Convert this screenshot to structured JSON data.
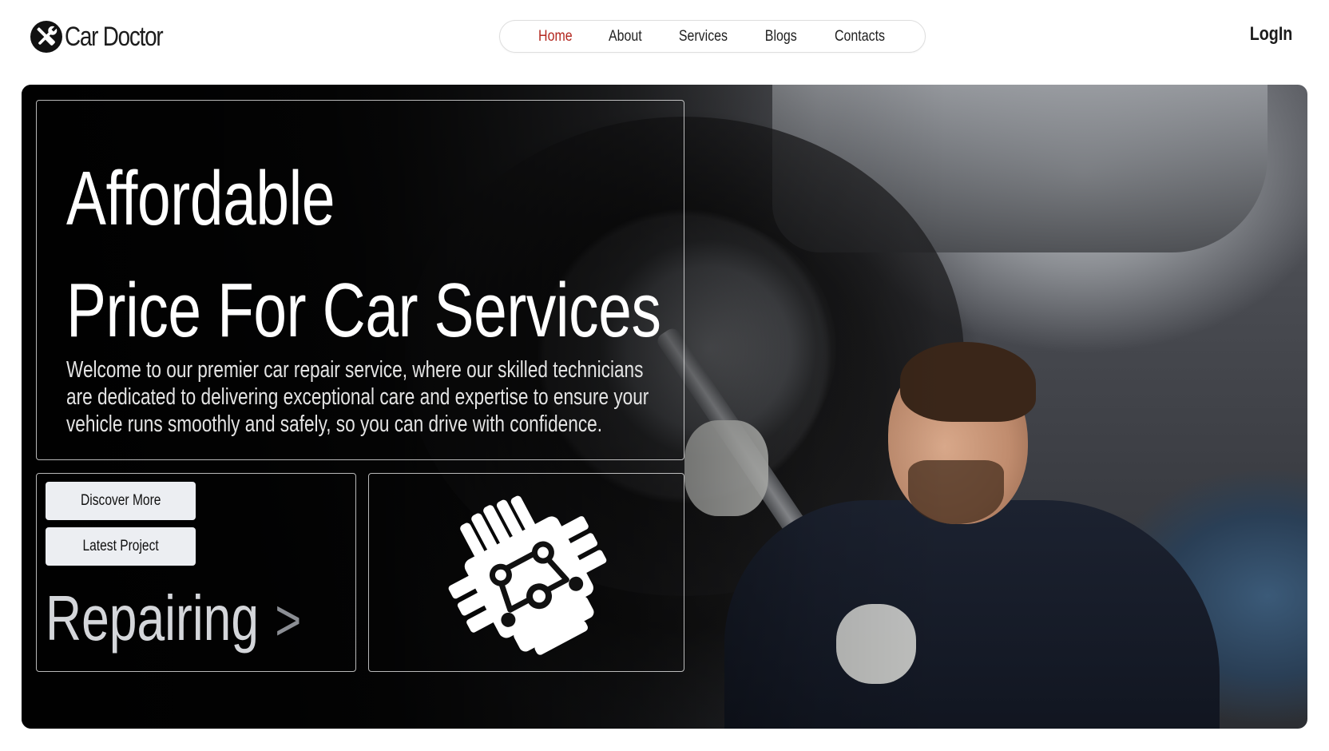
{
  "brand": {
    "name": "Car Doctor",
    "logo_icon": "wrench-screwdriver-icon"
  },
  "nav": {
    "items": [
      {
        "label": "Home",
        "active": true
      },
      {
        "label": "About",
        "active": false
      },
      {
        "label": "Services",
        "active": false
      },
      {
        "label": "Blogs",
        "active": false
      },
      {
        "label": "Contacts",
        "active": false
      }
    ],
    "login_label": "LogIn"
  },
  "hero": {
    "headline_line1": "Affordable",
    "headline_line2": "Price For Car Services",
    "description": "Welcome to our premier car repair service, where our skilled technicians are dedicated to delivering exceptional care and expertise to ensure your vehicle runs smoothly and safely, so you can drive with confidence.",
    "buttons": {
      "discover": "Discover More",
      "project": "Latest Project"
    },
    "repairing_label": "Repairing",
    "repairing_arrow": ">",
    "engine_icon": "engine-icon"
  },
  "colors": {
    "active_nav": "#b3261e",
    "button_bg": "#eceef2",
    "text_dark": "#1c1c1c"
  }
}
